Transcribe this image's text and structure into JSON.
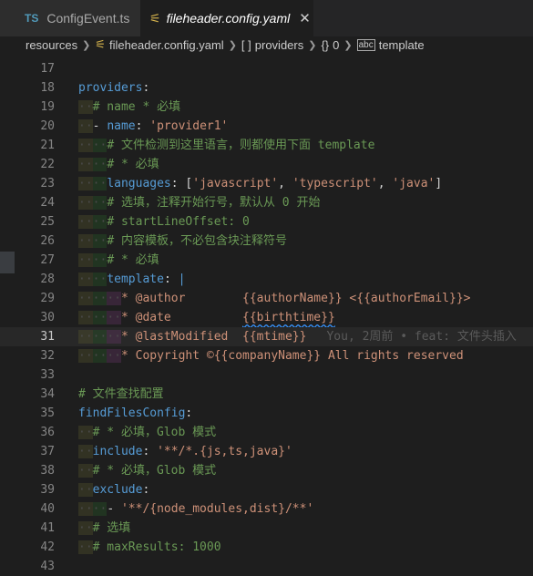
{
  "tabs": [
    {
      "icon": "TS",
      "label": "ConfigEvent.ts"
    },
    {
      "label": "fileheader.config.yaml",
      "close": "✕"
    }
  ],
  "breadcrumb": {
    "folder": "resources",
    "file": "fileheader.config.yaml",
    "providers": "providers",
    "index": "0",
    "template": "template"
  },
  "lines": [
    {
      "n": "17"
    },
    {
      "n": "18",
      "key": "providers",
      "colon": ":"
    },
    {
      "n": "19",
      "comment": "# name * 必填"
    },
    {
      "n": "20",
      "dash": "- ",
      "key": "name",
      "colon": ": ",
      "str": "'provider1'"
    },
    {
      "n": "21",
      "comment": "# 文件检测到这里语言，则都使用下面 template"
    },
    {
      "n": "22",
      "comment": "# * 必填"
    },
    {
      "n": "23",
      "key": "languages",
      "colon": ": ",
      "open": "[",
      "items": [
        "'javascript'",
        "'typescript'",
        "'java'"
      ],
      "sep": ", ",
      "close": "]"
    },
    {
      "n": "24",
      "comment": "# 选填，注释开始行号，默认从 0 开始"
    },
    {
      "n": "25",
      "comment": "# startLineOffset: 0"
    },
    {
      "n": "26",
      "comment": "# 内容模板，不必包含块注释符号"
    },
    {
      "n": "27",
      "comment": "# * 必填"
    },
    {
      "n": "28",
      "key": "template",
      "colon": ": ",
      "pipe": "|"
    },
    {
      "n": "29",
      "text": "* @author        {{authorName}} <{{authorEmail}}>"
    },
    {
      "n": "30",
      "text1": "* @date          ",
      "wavy": "{{birthtime}}"
    },
    {
      "n": "31",
      "text": "* @lastModified  {{mtime}}",
      "ghost": "You, 2周前 • feat: 文件头插入"
    },
    {
      "n": "32",
      "text": "* Copyright ©{{companyName}} All rights reserved"
    },
    {
      "n": "33"
    },
    {
      "n": "34",
      "comment": "# 文件查找配置"
    },
    {
      "n": "35",
      "key": "findFilesConfig",
      "colon": ":"
    },
    {
      "n": "36",
      "comment": "# * 必填，Glob 模式"
    },
    {
      "n": "37",
      "key": "include",
      "colon": ": ",
      "str": "'**/*.{js,ts,java}'"
    },
    {
      "n": "38",
      "comment": "# * 必填，Glob 模式"
    },
    {
      "n": "39",
      "key": "exclude",
      "colon": ":"
    },
    {
      "n": "40",
      "dash": "- ",
      "str": "'**/{node_modules,dist}/**'"
    },
    {
      "n": "41",
      "comment": "# 选填"
    },
    {
      "n": "42",
      "comment": "# maxResults: 1000"
    },
    {
      "n": "43"
    }
  ]
}
